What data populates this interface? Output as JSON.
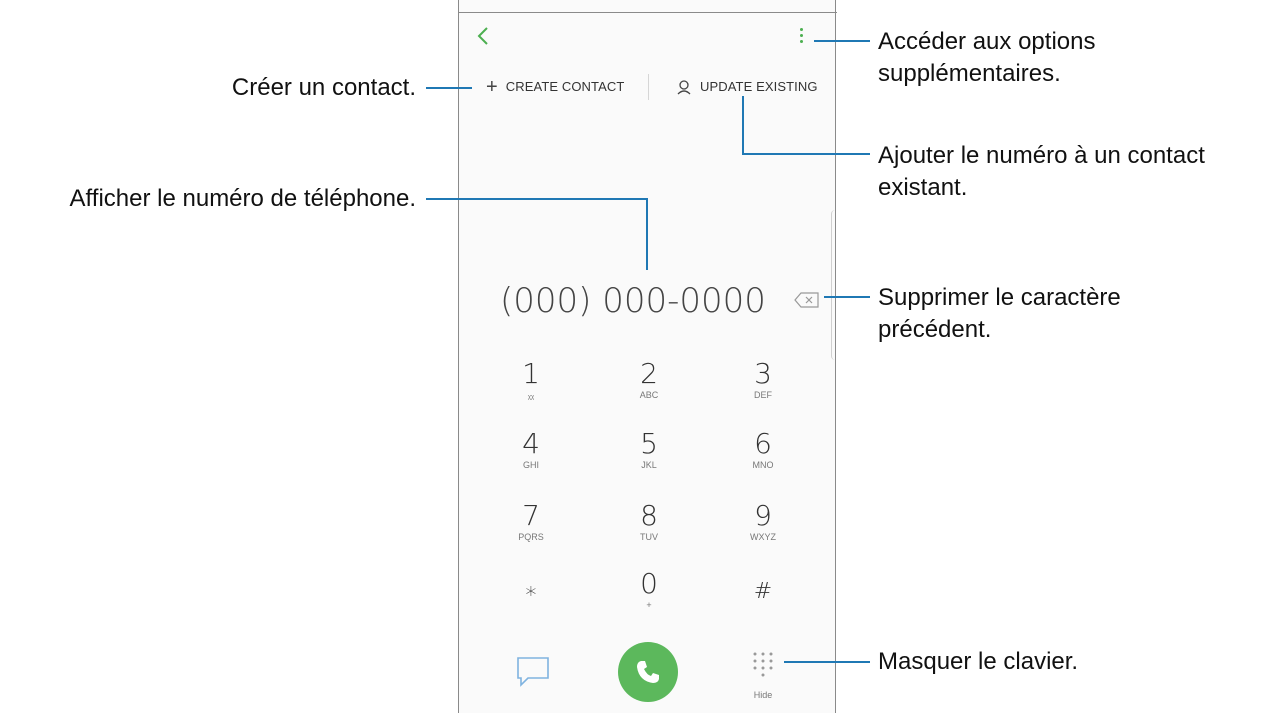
{
  "header": {
    "back_icon": "chevron-left-icon",
    "more_icon": "more-vertical-icon",
    "create_contact_label": "CREATE CONTACT",
    "update_existing_label": "UPDATE EXISTING"
  },
  "display": {
    "number": "(000) 000-0000",
    "backspace_icon": "backspace-icon"
  },
  "keypad": [
    {
      "digit": "1",
      "letters": "ᵪᵪ"
    },
    {
      "digit": "2",
      "letters": "ABC"
    },
    {
      "digit": "3",
      "letters": "DEF"
    },
    {
      "digit": "4",
      "letters": "GHI"
    },
    {
      "digit": "5",
      "letters": "JKL"
    },
    {
      "digit": "6",
      "letters": "MNO"
    },
    {
      "digit": "7",
      "letters": "PQRS"
    },
    {
      "digit": "8",
      "letters": "TUV"
    },
    {
      "digit": "9",
      "letters": "WXYZ"
    },
    {
      "digit": "∗",
      "letters": ""
    },
    {
      "digit": "0",
      "letters": "+"
    },
    {
      "digit": "#",
      "letters": ""
    }
  ],
  "bottom_bar": {
    "message_icon": "message-icon",
    "call_icon": "phone-icon",
    "hide_icon": "keypad-icon",
    "hide_label": "Hide"
  },
  "callouts": {
    "create_contact": "Créer un contact.",
    "more_options_line1": "Accéder aux options",
    "more_options_line2": "supplémentaires.",
    "update_existing_line1": "Ajouter le numéro à un contact",
    "update_existing_line2": "existant.",
    "show_number": "Afficher le numéro de téléphone.",
    "delete_line1": "Supprimer le caractère",
    "delete_line2": "précédent.",
    "hide_keypad": "Masquer le clavier."
  },
  "colors": {
    "accent_green": "#4caf50",
    "callout_line": "#1f78b4"
  }
}
